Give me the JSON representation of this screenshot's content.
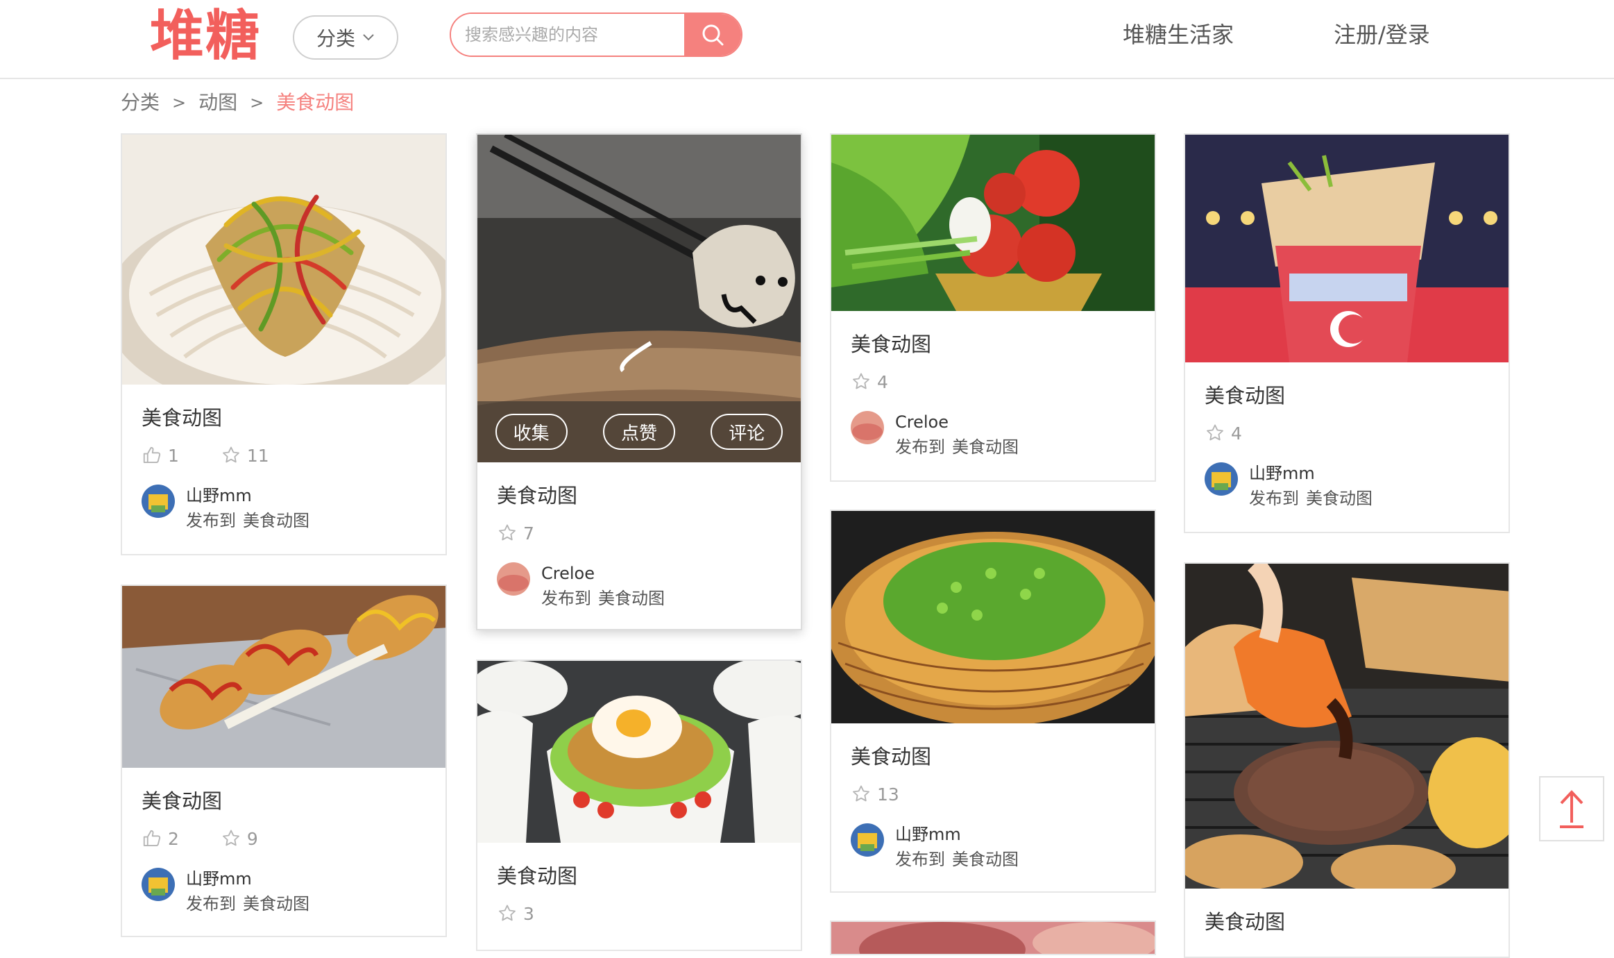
{
  "header": {
    "logo": "堆糖",
    "category_btn": "分类",
    "search_placeholder": "搜索感兴趣的内容",
    "nav_life": "堆糖生活家",
    "nav_login": "注册/登录"
  },
  "breadcrumb": {
    "root": "分类",
    "sep1": ">",
    "level2": "动图",
    "sep2": ">",
    "current": "美食动图"
  },
  "colors": {
    "accent": "#f5817e",
    "logo": "#f25f5c"
  },
  "cards": [
    {
      "title": "美食动图",
      "likes": "1",
      "favs": "11",
      "author": "山野mm",
      "posted": "发布到",
      "board": "美食动图"
    },
    {
      "title": "美食动图",
      "favs": "7",
      "author": "Creloe",
      "posted": "发布到",
      "board": "美食动图",
      "actions": {
        "collect": "收集",
        "like": "点赞",
        "comment": "评论"
      }
    },
    {
      "title": "美食动图",
      "favs": "4",
      "author": "Creloe",
      "posted": "发布到",
      "board": "美食动图"
    },
    {
      "title": "美食动图",
      "favs": "4",
      "author": "山野mm",
      "posted": "发布到",
      "board": "美食动图"
    },
    {
      "title": "美食动图",
      "likes": "2",
      "favs": "9",
      "author": "山野mm",
      "posted": "发布到",
      "board": "美食动图"
    },
    {
      "title": "美食动图",
      "favs": "13",
      "author": "山野mm",
      "posted": "发布到",
      "board": "美食动图"
    },
    {
      "title": "美食动图",
      "favs": "3"
    },
    {
      "title": "美食动图"
    }
  ]
}
